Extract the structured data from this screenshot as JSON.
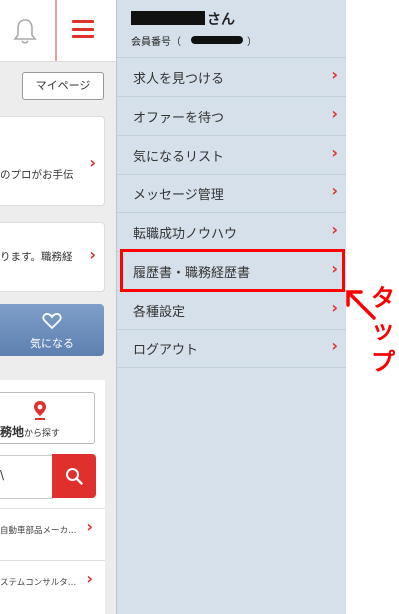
{
  "header": {
    "bell_icon": "bell-icon",
    "menu_icon": "hamburger-icon"
  },
  "main": {
    "mypage_label": "マイページ",
    "card1_text": "のプロがお手伝",
    "card2_text": "ります。職務経",
    "fav_label": "気になる",
    "area_bold": "務地",
    "area_small": "から探す",
    "search_value": "\\",
    "list": [
      {
        "text": "自動車部品メーカ…"
      },
      {
        "text": "ステムコンサルタ…"
      }
    ]
  },
  "drawer": {
    "user_suffix": "さん",
    "member_label": "会員番号（",
    "member_close": "）",
    "items": [
      {
        "label": "求人を見つける"
      },
      {
        "label": "オファーを待つ"
      },
      {
        "label": "気になるリスト"
      },
      {
        "label": "メッセージ管理"
      },
      {
        "label": "転職成功ノウハウ"
      },
      {
        "label": "履歴書・職務経歴書"
      },
      {
        "label": "各種設定"
      },
      {
        "label": "ログアウト"
      }
    ],
    "chevron": "›"
  },
  "annotation": {
    "chars": [
      "タ",
      "ッ",
      "プ"
    ]
  },
  "colors": {
    "accent": "#e0302d",
    "drawer_bg": "#d6e0ea",
    "highlight": "#ff0000"
  }
}
